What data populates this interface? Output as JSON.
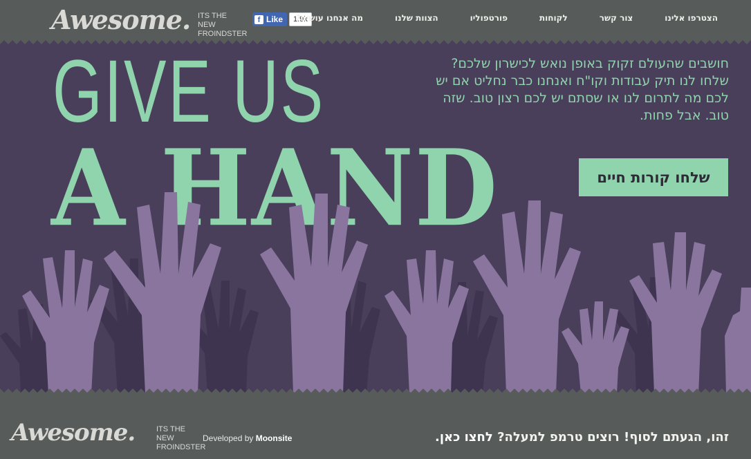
{
  "header": {
    "logo": "Awesome.",
    "tagline": "ITS THE NEW FROINDSTER",
    "fb_like_label": "Like",
    "fb_like_count": "1.9k",
    "nav": [
      "מה אנחנו עושים?",
      "הצוות שלנו",
      "פורטפוליו",
      "לקוחות",
      "צור קשר",
      "הצטרפו אלינו"
    ]
  },
  "hero": {
    "headline_line1": "GIVE US",
    "headline_line2": "A HAND",
    "body": "חושבים שהעולם זקוק באופן נואש לכישרון שלכם? שלחו לנו תיק עבודות וקו\"ח ואנחנו כבר נחליט אם יש לכם מה לתרום לנו או שסתם יש לכם רצון טוב. שזה טוב. אבל פחות.",
    "cta_label": "שלחו קורות חיים"
  },
  "footer": {
    "logo": "Awesome.",
    "tagline": "ITS THE NEW FROINDSTER",
    "developed_prefix": "Developed by",
    "developed_by": "Moonsite",
    "message": "זהו, הגעתם לסוף! רוצים טרמפ למעלה?",
    "message_link": "לחצו כאן."
  },
  "colors": {
    "header_bg": "#575c5b",
    "hero_bg": "#4a3f5b",
    "accent_green": "#8fd4ac",
    "hand_light": "#8a759f",
    "hand_dark": "#3e3450"
  }
}
